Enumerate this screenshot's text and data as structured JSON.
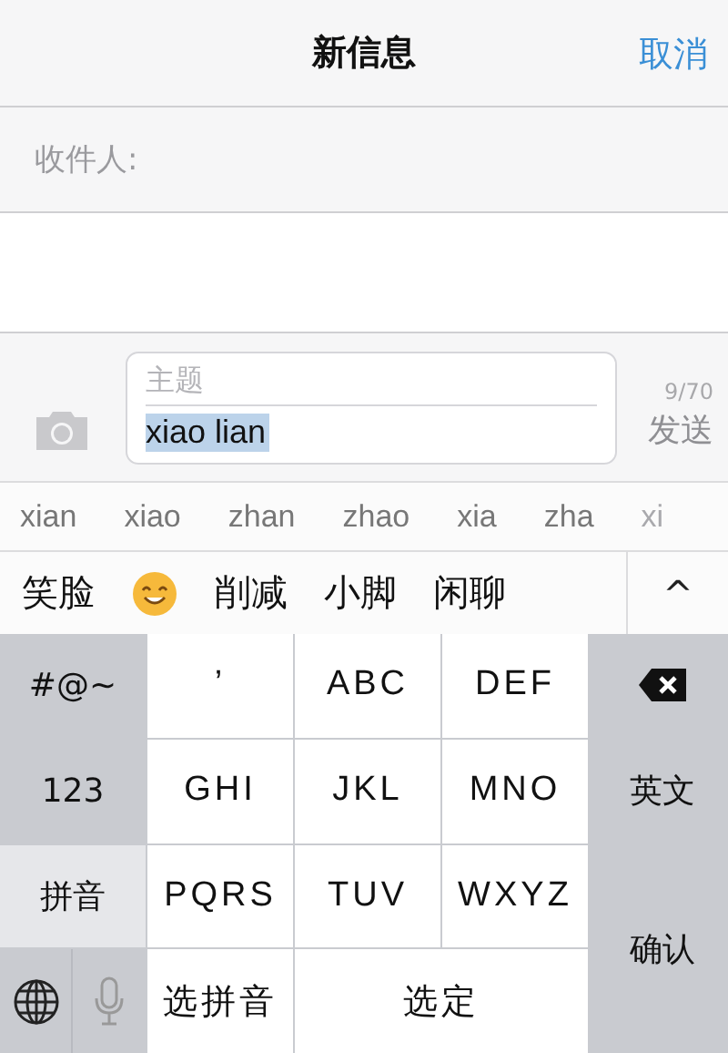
{
  "nav": {
    "title": "新信息",
    "cancel": "取消"
  },
  "recipient": {
    "label": "收件人:"
  },
  "compose": {
    "subject_placeholder": "主题",
    "text": "xiao lian",
    "highlighted": true,
    "counter": "9/70",
    "send": "发送"
  },
  "pinyin": [
    {
      "text": "xian",
      "dimmed": false
    },
    {
      "text": "xiao",
      "dimmed": false
    },
    {
      "text": "zhan",
      "dimmed": false
    },
    {
      "text": "zhao",
      "dimmed": false
    },
    {
      "text": "xia",
      "dimmed": false
    },
    {
      "text": "zha",
      "dimmed": false
    },
    {
      "text": "xi",
      "dimmed": true
    }
  ],
  "candidates": [
    {
      "kind": "word",
      "text": "笑脸"
    },
    {
      "kind": "emoji"
    },
    {
      "kind": "word",
      "text": "削减"
    },
    {
      "kind": "word",
      "text": "小脚"
    },
    {
      "kind": "word",
      "text": "闲聊"
    }
  ],
  "expand": "^",
  "keys": [
    {
      "kind": "function",
      "label": "#@~",
      "selected": false
    },
    {
      "kind": "letter",
      "label": "’"
    },
    {
      "kind": "letter",
      "label": "ABC"
    },
    {
      "kind": "letter",
      "label": "DEF"
    },
    {
      "kind": "delete"
    },
    {
      "kind": "function",
      "label": "123",
      "selected": false
    },
    {
      "kind": "letter",
      "label": "GHI"
    },
    {
      "kind": "letter",
      "label": "JKL"
    },
    {
      "kind": "letter",
      "label": "MNO"
    },
    {
      "kind": "function",
      "label": "英文",
      "selected": false
    },
    {
      "kind": "function",
      "label": "拼音",
      "selected": true
    },
    {
      "kind": "letter",
      "label": "PQRS"
    },
    {
      "kind": "letter",
      "label": "TUV"
    },
    {
      "kind": "letter",
      "label": "WXYZ"
    },
    {
      "kind": "function",
      "label": "确认",
      "selected": false
    },
    {
      "kind": "globe"
    },
    {
      "kind": "mic"
    },
    {
      "kind": "letter",
      "label": "选拼音"
    },
    {
      "kind": "letter",
      "label": "选定"
    }
  ]
}
